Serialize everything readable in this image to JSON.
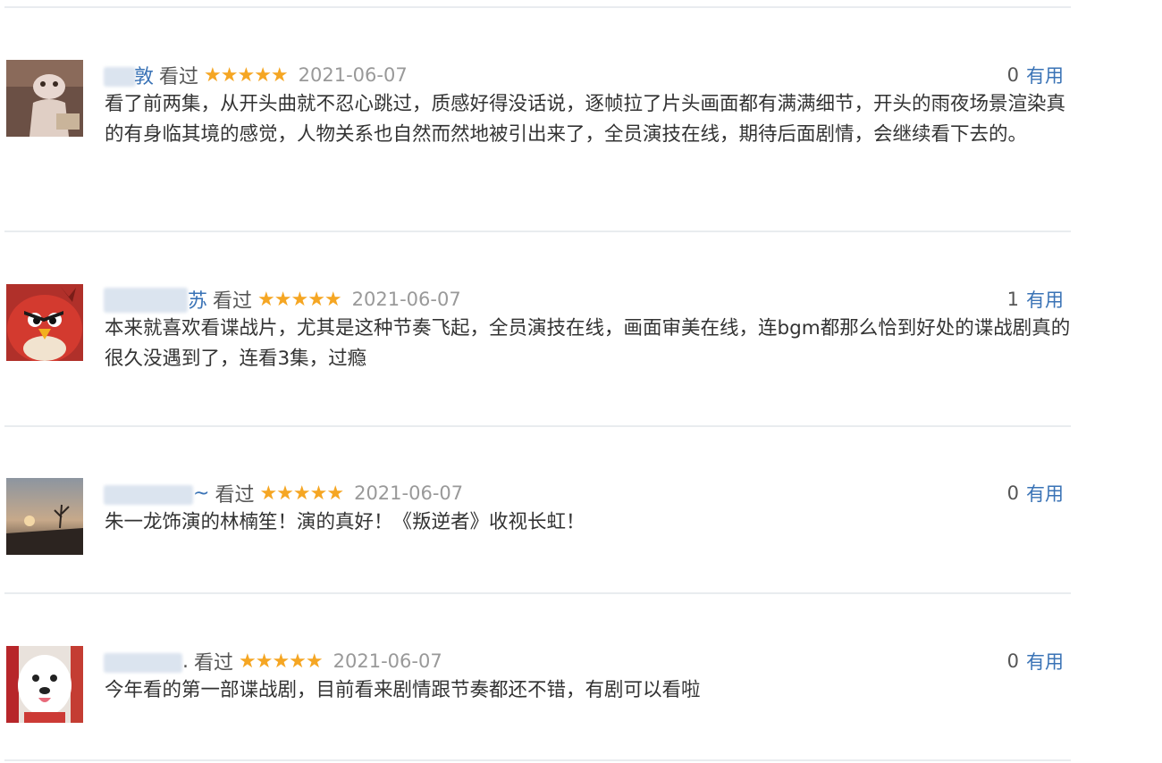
{
  "reviews": [
    {
      "name_visible": "敦",
      "watched": "看过",
      "stars": "★★★★★",
      "date": "2021-06-07",
      "useful_count": "0",
      "useful_label": "有用",
      "content": "看了前两集，从开头曲就不忍心跳过，质感好得没话说，逐帧拉了片头画面都有满满细节，开头的雨夜场景渲染真的有身临其境的感觉，人物关系也自然而然地被引出来了，全员演技在线，期待后面剧情，会继续看下去的。",
      "avatar_icon": "cat-avatar-icon"
    },
    {
      "name_visible": "苏",
      "watched": "看过",
      "stars": "★★★★★",
      "date": "2021-06-07",
      "useful_count": "1",
      "useful_label": "有用",
      "content": "本来就喜欢看谍战片，尤其是这种节奏飞起，全员演技在线，画面审美在线，连bgm都那么恰到好处的谍战剧真的很久没遇到了，连看3集，过瘾",
      "avatar_icon": "angry-bird-avatar-icon"
    },
    {
      "name_visible": "~",
      "watched": "看过",
      "stars": "★★★★★",
      "date": "2021-06-07",
      "useful_count": "0",
      "useful_label": "有用",
      "content": "朱一龙饰演的林楠笙！演的真好！《叛逆者》收视长虹！",
      "avatar_icon": "sunset-avatar-icon"
    },
    {
      "name_visible": ".",
      "watched": "看过",
      "stars": "★★★★★",
      "date": "2021-06-07",
      "useful_count": "0",
      "useful_label": "有用",
      "content": "今年看的第一部谍战剧，目前看来剧情跟节奏都还不错，有剧可以看啦",
      "avatar_icon": "white-dog-avatar-icon"
    }
  ]
}
